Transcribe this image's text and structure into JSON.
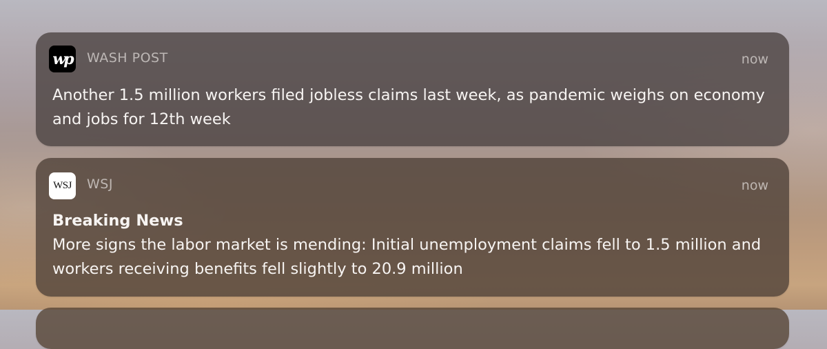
{
  "notifications": [
    {
      "app": "WASH POST",
      "icon": "washington-post-icon",
      "icon_text": "wp",
      "time": "now",
      "title": "",
      "body": "Another 1.5 million workers filed jobless claims last week, as pandemic weighs on economy and jobs for 12th week"
    },
    {
      "app": "WSJ",
      "icon": "wsj-icon",
      "icon_text": "WSJ",
      "time": "now",
      "title": "Breaking News",
      "body": "More signs the labor market is mending: Initial unemployment claims fell to 1.5 million and workers receiving benefits fell slightly to 20.9 million"
    }
  ]
}
